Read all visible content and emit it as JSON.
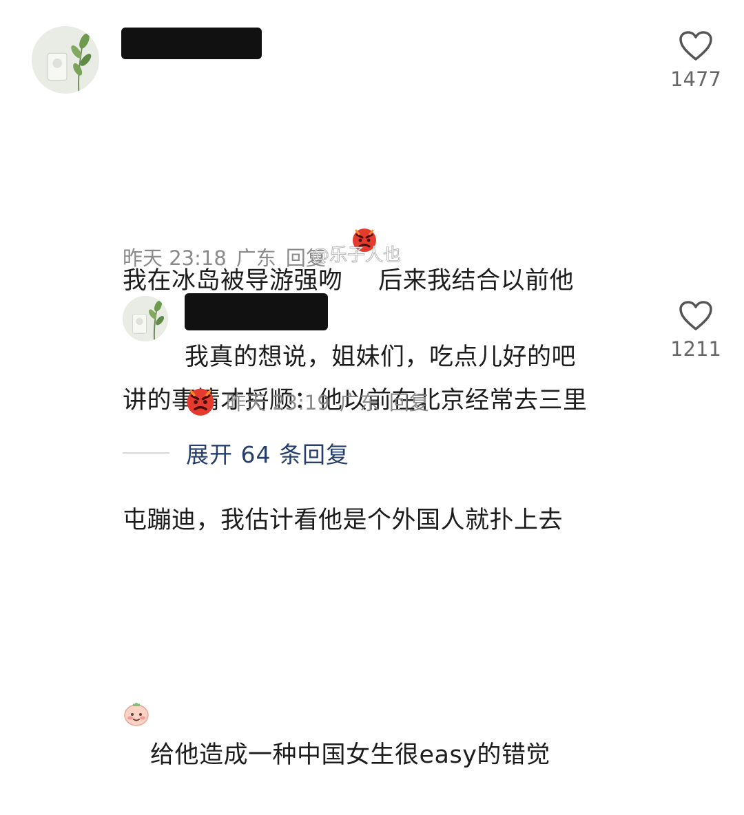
{
  "comments": [
    {
      "lines": [
        "我在冰岛被导游强吻 ",
        "后来我结合以前他",
        "讲的事情才捋顺：他以前在北京经常去三里",
        "屯蹦迪，我估计看他是个外国人就扑上去",
        "给他造成一种中国女生很easy的错觉"
      ],
      "time": "昨天 23:18",
      "location": "广东",
      "reply_label": "回复",
      "like_count": "1477"
    },
    {
      "text": "我真的想说，姐妹们，吃点儿好的吧",
      "time": "昨天 23:19",
      "location": "广东",
      "reply_label": "回复",
      "like_count": "1211"
    }
  ],
  "watermark": "@乐子人也",
  "expand": {
    "label": "展开 64 条回复"
  },
  "icons": {
    "like": "heart-outline-icon",
    "angry": "angry-face-emoji",
    "blush": "blushing-face-emoji"
  },
  "colors": {
    "text": "#1c1c1c",
    "meta": "#8a8a8a",
    "expand_link": "#253e6b",
    "redaction": "#111111"
  }
}
